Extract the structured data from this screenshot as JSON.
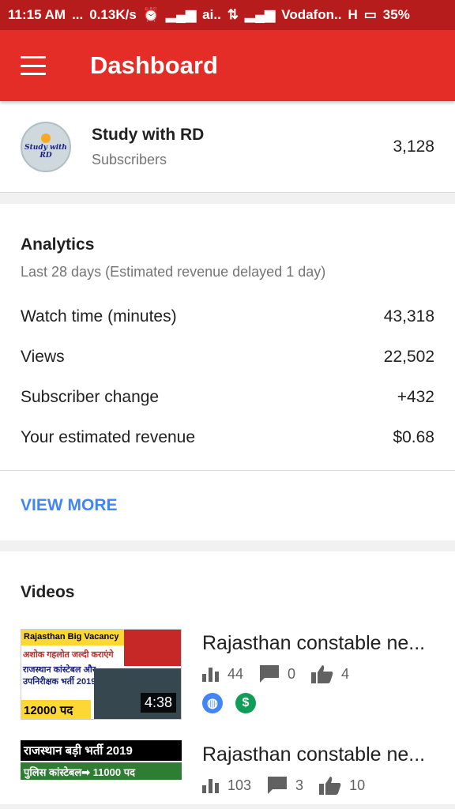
{
  "status_bar": {
    "time": "11:15 AM",
    "dots": "...",
    "speed": "0.13K/s",
    "carrier1": "ai..",
    "carrier2": "Vodafon..",
    "network": "H",
    "battery": "35%"
  },
  "app_bar": {
    "title": "Dashboard"
  },
  "channel": {
    "avatar_text": "Study with RD",
    "name": "Study with RD",
    "subscribers_label": "Subscribers",
    "subscribers_count": "3,128"
  },
  "analytics": {
    "title": "Analytics",
    "subtitle": "Last 28 days (Estimated revenue delayed 1 day)",
    "rows": [
      {
        "label": "Watch time (minutes)",
        "value": "43,318"
      },
      {
        "label": "Views",
        "value": "22,502"
      },
      {
        "label": "Subscriber change",
        "value": "+432"
      },
      {
        "label": "Your estimated revenue",
        "value": "$0.68"
      }
    ],
    "view_more": "VIEW MORE"
  },
  "videos": {
    "title": "Videos",
    "items": [
      {
        "title": "Rajasthan constable ne...",
        "duration": "4:38",
        "views": "44",
        "comments": "0",
        "likes": "4",
        "thumb_text": [
          "Rajasthan  Big Vacancy",
          "अशोक गहलोत जल्दी कराएंगे",
          "राजस्थान कांस्टेबल और उपनिरीक्षक भर्ती  2019",
          "12000 पद"
        ]
      },
      {
        "title": "Rajasthan constable ne...",
        "views": "103",
        "comments": "3",
        "likes": "10",
        "thumb_text": [
          "राजस्थान बड़ी भर्ती 2019",
          "पुलिस कांस्टेबल➡ 11000 पद"
        ]
      }
    ]
  },
  "colors": {
    "brand": "#e52d27",
    "status_bar": "#b71c1c",
    "link": "#4285f4"
  }
}
